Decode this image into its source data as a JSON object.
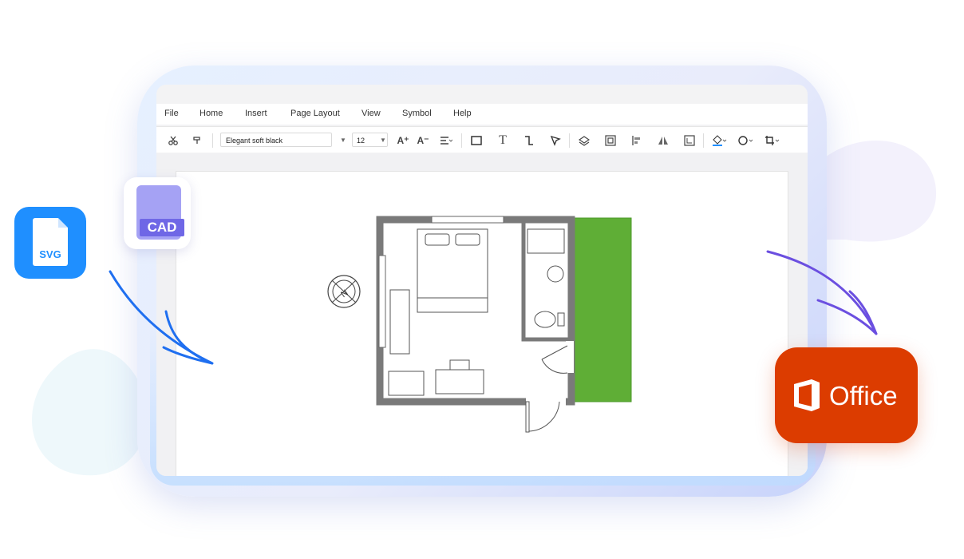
{
  "menu": [
    "File",
    "Home",
    "Insert",
    "Page Layout",
    "View",
    "Symbol",
    "Help"
  ],
  "toolbar": {
    "font_name": "Elegant soft black",
    "font_size": "12",
    "icons": [
      "cut-icon",
      "format-painter-icon",
      "font-grow-icon",
      "font-shrink-icon",
      "align-icon",
      "rectangle-icon",
      "text-icon",
      "connector-icon",
      "pointer-icon",
      "layers-icon",
      "group-icon",
      "align-left-icon",
      "flip-icon",
      "frame-icon",
      "fill-color-icon",
      "line-color-icon",
      "crop-icon"
    ]
  },
  "badges": {
    "svg": "SVG",
    "cad": "CAD",
    "office": "Office"
  },
  "colors": {
    "accent_blue": "#1f8fff",
    "cad_purple": "#6f67e6",
    "office_orange": "#dc3c00",
    "arrow_purple": "#6b4fe0",
    "grass_green": "#5fae36",
    "wall_gray": "#7a7a7a"
  }
}
